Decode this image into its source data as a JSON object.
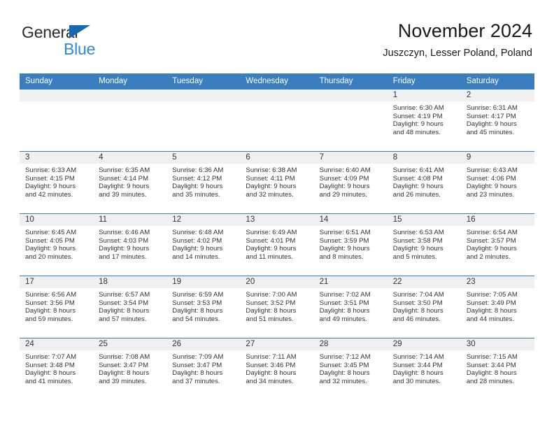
{
  "brand": {
    "name_part1": "General",
    "name_part2": "Blue",
    "triangle_color": "#1668b3",
    "text_color": "#2b2b2b",
    "blue_color": "#2e8ad6"
  },
  "header": {
    "title": "November 2024",
    "subtitle": "Juszczyn, Lesser Poland, Poland",
    "accent_color": "#3a7ebf"
  },
  "weekdays": [
    "Sunday",
    "Monday",
    "Tuesday",
    "Wednesday",
    "Thursday",
    "Friday",
    "Saturday"
  ],
  "labels": {
    "sunrise_prefix": "Sunrise:",
    "sunset_prefix": "Sunset:",
    "daylight_prefix": "Daylight:"
  },
  "weeks": [
    [
      {
        "day": "",
        "blank": true
      },
      {
        "day": "",
        "blank": true
      },
      {
        "day": "",
        "blank": true
      },
      {
        "day": "",
        "blank": true
      },
      {
        "day": "",
        "blank": true
      },
      {
        "day": "1",
        "sunrise": "Sunrise: 6:30 AM",
        "sunset": "Sunset: 4:19 PM",
        "daylight_line1": "Daylight: 9 hours",
        "daylight_line2": "and 48 minutes."
      },
      {
        "day": "2",
        "sunrise": "Sunrise: 6:31 AM",
        "sunset": "Sunset: 4:17 PM",
        "daylight_line1": "Daylight: 9 hours",
        "daylight_line2": "and 45 minutes."
      }
    ],
    [
      {
        "day": "3",
        "sunrise": "Sunrise: 6:33 AM",
        "sunset": "Sunset: 4:15 PM",
        "daylight_line1": "Daylight: 9 hours",
        "daylight_line2": "and 42 minutes."
      },
      {
        "day": "4",
        "sunrise": "Sunrise: 6:35 AM",
        "sunset": "Sunset: 4:14 PM",
        "daylight_line1": "Daylight: 9 hours",
        "daylight_line2": "and 39 minutes."
      },
      {
        "day": "5",
        "sunrise": "Sunrise: 6:36 AM",
        "sunset": "Sunset: 4:12 PM",
        "daylight_line1": "Daylight: 9 hours",
        "daylight_line2": "and 35 minutes."
      },
      {
        "day": "6",
        "sunrise": "Sunrise: 6:38 AM",
        "sunset": "Sunset: 4:11 PM",
        "daylight_line1": "Daylight: 9 hours",
        "daylight_line2": "and 32 minutes."
      },
      {
        "day": "7",
        "sunrise": "Sunrise: 6:40 AM",
        "sunset": "Sunset: 4:09 PM",
        "daylight_line1": "Daylight: 9 hours",
        "daylight_line2": "and 29 minutes."
      },
      {
        "day": "8",
        "sunrise": "Sunrise: 6:41 AM",
        "sunset": "Sunset: 4:08 PM",
        "daylight_line1": "Daylight: 9 hours",
        "daylight_line2": "and 26 minutes."
      },
      {
        "day": "9",
        "sunrise": "Sunrise: 6:43 AM",
        "sunset": "Sunset: 4:06 PM",
        "daylight_line1": "Daylight: 9 hours",
        "daylight_line2": "and 23 minutes."
      }
    ],
    [
      {
        "day": "10",
        "sunrise": "Sunrise: 6:45 AM",
        "sunset": "Sunset: 4:05 PM",
        "daylight_line1": "Daylight: 9 hours",
        "daylight_line2": "and 20 minutes."
      },
      {
        "day": "11",
        "sunrise": "Sunrise: 6:46 AM",
        "sunset": "Sunset: 4:03 PM",
        "daylight_line1": "Daylight: 9 hours",
        "daylight_line2": "and 17 minutes."
      },
      {
        "day": "12",
        "sunrise": "Sunrise: 6:48 AM",
        "sunset": "Sunset: 4:02 PM",
        "daylight_line1": "Daylight: 9 hours",
        "daylight_line2": "and 14 minutes."
      },
      {
        "day": "13",
        "sunrise": "Sunrise: 6:49 AM",
        "sunset": "Sunset: 4:01 PM",
        "daylight_line1": "Daylight: 9 hours",
        "daylight_line2": "and 11 minutes."
      },
      {
        "day": "14",
        "sunrise": "Sunrise: 6:51 AM",
        "sunset": "Sunset: 3:59 PM",
        "daylight_line1": "Daylight: 9 hours",
        "daylight_line2": "and 8 minutes."
      },
      {
        "day": "15",
        "sunrise": "Sunrise: 6:53 AM",
        "sunset": "Sunset: 3:58 PM",
        "daylight_line1": "Daylight: 9 hours",
        "daylight_line2": "and 5 minutes."
      },
      {
        "day": "16",
        "sunrise": "Sunrise: 6:54 AM",
        "sunset": "Sunset: 3:57 PM",
        "daylight_line1": "Daylight: 9 hours",
        "daylight_line2": "and 2 minutes."
      }
    ],
    [
      {
        "day": "17",
        "sunrise": "Sunrise: 6:56 AM",
        "sunset": "Sunset: 3:56 PM",
        "daylight_line1": "Daylight: 8 hours",
        "daylight_line2": "and 59 minutes."
      },
      {
        "day": "18",
        "sunrise": "Sunrise: 6:57 AM",
        "sunset": "Sunset: 3:54 PM",
        "daylight_line1": "Daylight: 8 hours",
        "daylight_line2": "and 57 minutes."
      },
      {
        "day": "19",
        "sunrise": "Sunrise: 6:59 AM",
        "sunset": "Sunset: 3:53 PM",
        "daylight_line1": "Daylight: 8 hours",
        "daylight_line2": "and 54 minutes."
      },
      {
        "day": "20",
        "sunrise": "Sunrise: 7:00 AM",
        "sunset": "Sunset: 3:52 PM",
        "daylight_line1": "Daylight: 8 hours",
        "daylight_line2": "and 51 minutes."
      },
      {
        "day": "21",
        "sunrise": "Sunrise: 7:02 AM",
        "sunset": "Sunset: 3:51 PM",
        "daylight_line1": "Daylight: 8 hours",
        "daylight_line2": "and 49 minutes."
      },
      {
        "day": "22",
        "sunrise": "Sunrise: 7:04 AM",
        "sunset": "Sunset: 3:50 PM",
        "daylight_line1": "Daylight: 8 hours",
        "daylight_line2": "and 46 minutes."
      },
      {
        "day": "23",
        "sunrise": "Sunrise: 7:05 AM",
        "sunset": "Sunset: 3:49 PM",
        "daylight_line1": "Daylight: 8 hours",
        "daylight_line2": "and 44 minutes."
      }
    ],
    [
      {
        "day": "24",
        "sunrise": "Sunrise: 7:07 AM",
        "sunset": "Sunset: 3:48 PM",
        "daylight_line1": "Daylight: 8 hours",
        "daylight_line2": "and 41 minutes."
      },
      {
        "day": "25",
        "sunrise": "Sunrise: 7:08 AM",
        "sunset": "Sunset: 3:47 PM",
        "daylight_line1": "Daylight: 8 hours",
        "daylight_line2": "and 39 minutes."
      },
      {
        "day": "26",
        "sunrise": "Sunrise: 7:09 AM",
        "sunset": "Sunset: 3:47 PM",
        "daylight_line1": "Daylight: 8 hours",
        "daylight_line2": "and 37 minutes."
      },
      {
        "day": "27",
        "sunrise": "Sunrise: 7:11 AM",
        "sunset": "Sunset: 3:46 PM",
        "daylight_line1": "Daylight: 8 hours",
        "daylight_line2": "and 34 minutes."
      },
      {
        "day": "28",
        "sunrise": "Sunrise: 7:12 AM",
        "sunset": "Sunset: 3:45 PM",
        "daylight_line1": "Daylight: 8 hours",
        "daylight_line2": "and 32 minutes."
      },
      {
        "day": "29",
        "sunrise": "Sunrise: 7:14 AM",
        "sunset": "Sunset: 3:44 PM",
        "daylight_line1": "Daylight: 8 hours",
        "daylight_line2": "and 30 minutes."
      },
      {
        "day": "30",
        "sunrise": "Sunrise: 7:15 AM",
        "sunset": "Sunset: 3:44 PM",
        "daylight_line1": "Daylight: 8 hours",
        "daylight_line2": "and 28 minutes."
      }
    ]
  ]
}
